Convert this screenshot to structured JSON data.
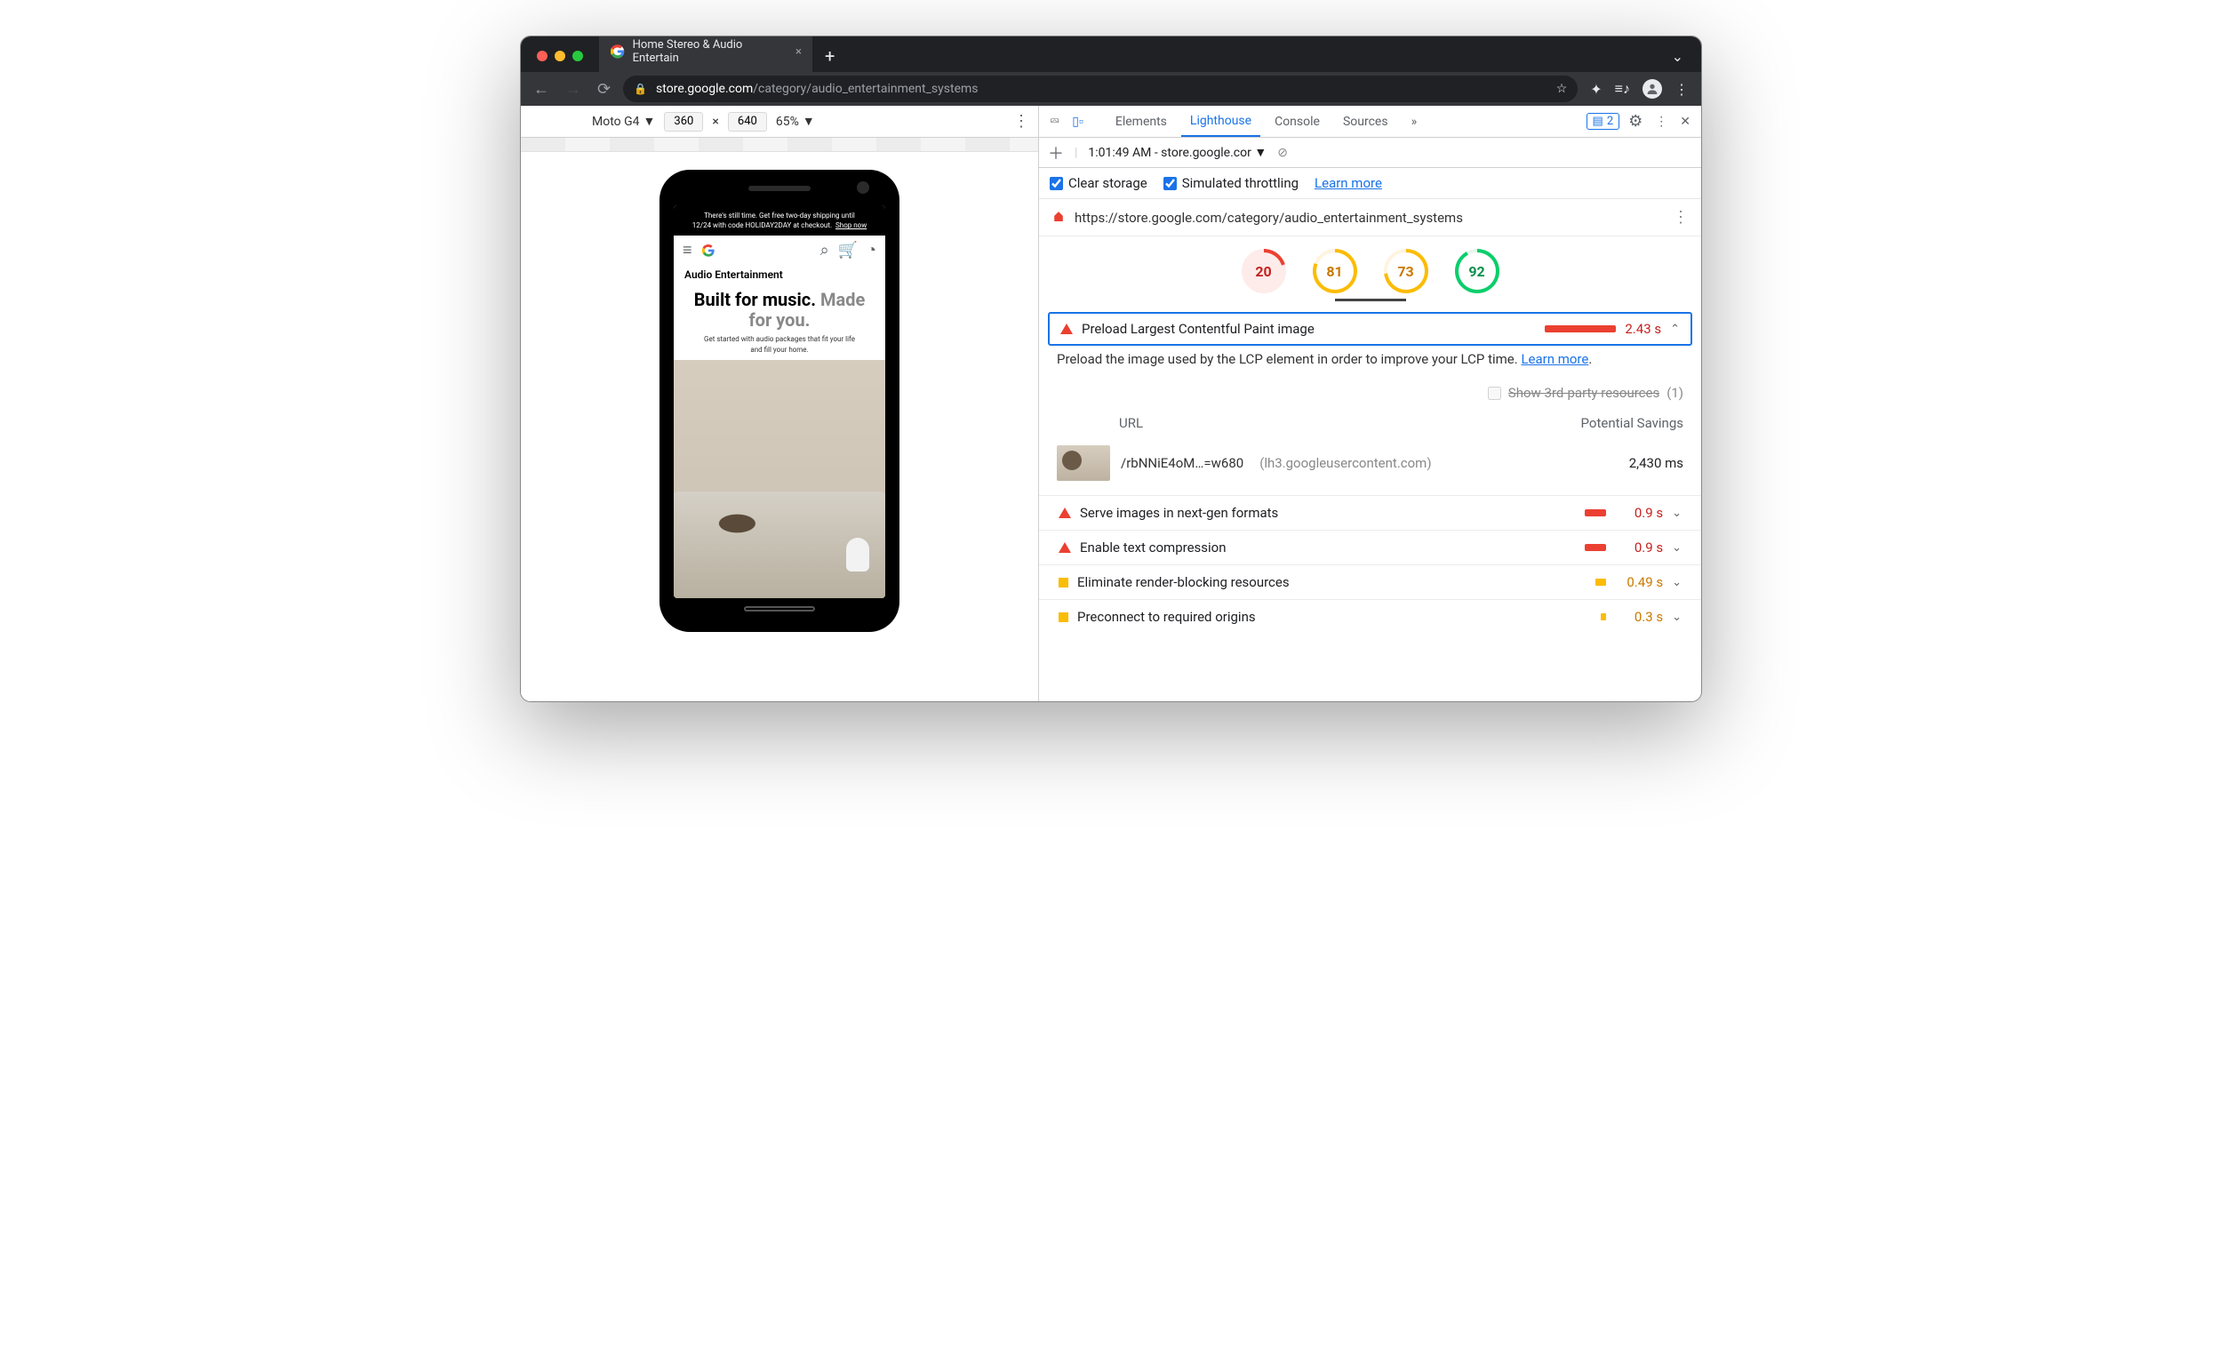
{
  "browser": {
    "tab_title": "Home Stereo & Audio Entertain",
    "url_host": "store.google.com",
    "url_path": "/category/audio_entertainment_systems"
  },
  "device_toolbar": {
    "device": "Moto G4",
    "w": "360",
    "h": "640",
    "zoom": "65%"
  },
  "mobile_page": {
    "promo_a": "There's still time. Get free two-day shipping until",
    "promo_b": "12/24 with code HOLIDAY2DAY at checkout.",
    "promo_link": "Shop now",
    "section": "Audio Entertainment",
    "headline_a": "Built for music.",
    "headline_b": "Made for you.",
    "sub": "Get started with audio packages that fit your life and fill your home."
  },
  "devtools": {
    "tabs": [
      "Elements",
      "Lighthouse",
      "Console",
      "Sources"
    ],
    "more": "»",
    "issues_count": "2",
    "toolbar_time": "1:01:49 AM - store.google.cor",
    "clear_storage": "Clear storage",
    "sim_throttle": "Simulated throttling",
    "learn_more": "Learn more",
    "audit_url": "https://store.google.com/category/audio_entertainment_systems"
  },
  "scores": {
    "perf": "20",
    "a11y": "81",
    "bp": "73",
    "seo": "92"
  },
  "audit": {
    "title": "Preload Largest Contentful Paint image",
    "time": "2.43 s",
    "desc_a": "Preload the image used by the LCP element in order to improve your LCP time. ",
    "learn": "Learn more",
    "third_party": "Show 3rd-party resources",
    "third_party_count": "(1)",
    "col_url": "URL",
    "col_save": "Potential Savings",
    "row_url": "/rbNNiE4oM…=w680",
    "row_host": "(lh3.googleusercontent.com)",
    "row_save": "2,430 ms"
  },
  "other_audits": [
    {
      "title": "Serve images in next-gen formats",
      "val": "0.9 s",
      "sev": "red"
    },
    {
      "title": "Enable text compression",
      "val": "0.9 s",
      "sev": "red"
    },
    {
      "title": "Eliminate render-blocking resources",
      "val": "0.49 s",
      "sev": "orange"
    },
    {
      "title": "Preconnect to required origins",
      "val": "0.3 s",
      "sev": "orange"
    }
  ]
}
